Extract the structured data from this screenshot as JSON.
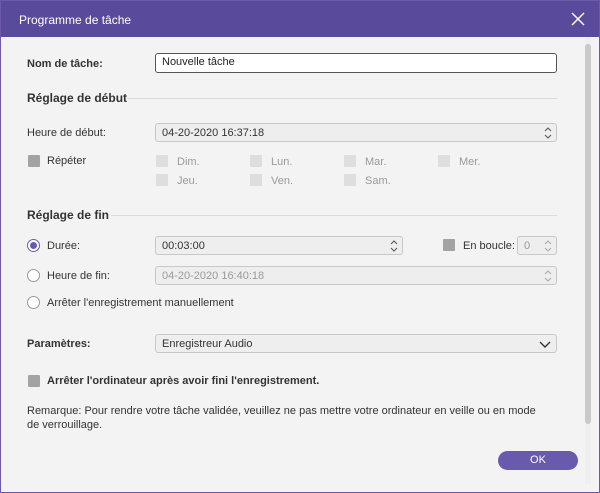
{
  "window": {
    "title": "Programme de tâche",
    "ok_label": "OK"
  },
  "task": {
    "name_label": "Nom de tâche:",
    "name_value": "Nouvelle tâche"
  },
  "start": {
    "section_label": "Réglage de début",
    "time_label": "Heure de début:",
    "time_value": "04-20-2020 16:37:18",
    "repeat_label": "Répéter",
    "days": {
      "mon_label": "Dim.",
      "tue_label": "Lun.",
      "wed_label": "Mar.",
      "thu_label": "Mer.",
      "fri_label": "Jeu.",
      "sat_label": "Ven.",
      "sun_label": "Sam."
    }
  },
  "end": {
    "section_label": "Réglage de fin",
    "duration_label": "Durée:",
    "duration_value": "00:03:00",
    "loop_label": "En boucle:",
    "loop_value": "0",
    "end_time_label": "Heure de fin:",
    "end_time_value": "04-20-2020 16:40:18",
    "manual_label": "Arrêter l'enregistrement manuellement"
  },
  "params": {
    "label": "Paramètres:",
    "selected": "Enregistreur Audio"
  },
  "shutdown": {
    "label": "Arrêter l'ordinateur après avoir fini l'enregistrement."
  },
  "note": {
    "text": "Remarque: Pour rendre votre tâche validée, veuillez ne pas mettre votre ordinateur en veille ou en mode de verrouillage."
  },
  "colors": {
    "accent": "#5a4a9c",
    "button": "#6a5aad"
  }
}
